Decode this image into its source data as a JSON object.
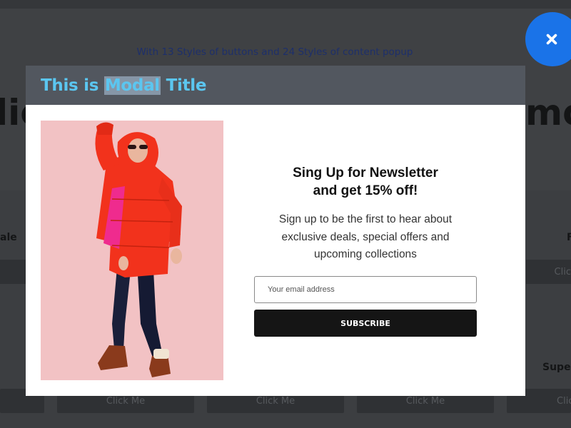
{
  "background": {
    "subtitle": "With 13 Styles of buttons and 24 Styles of content popup",
    "heading_left": "lic",
    "heading_right": "mo",
    "label_left": "ale",
    "label_right": "F",
    "label_super": "Super",
    "row1_button_right": "Clic",
    "row2_buttons": [
      "",
      "Click Me",
      "Click Me",
      "Click Me",
      "Clic"
    ]
  },
  "close_button": {
    "icon": "close-icon"
  },
  "modal": {
    "title_before": "This is ",
    "title_highlight": "Modal",
    "title_after": " Title",
    "image": {
      "icon": "woman-red-jacket-photo",
      "background": "#f2c2c4"
    },
    "newsletter": {
      "title_line1": "Sing Up for Newsletter",
      "title_line2": "and get 15% off!",
      "description_line1": "Sign up to be the first to hear about",
      "description_line2": "exclusive deals, special offers and",
      "description_line3": "upcoming collections",
      "email_placeholder": "Your email address",
      "subscribe_label": "SUBSCRIBE"
    }
  },
  "colors": {
    "accent_blue": "#1a73e8",
    "title_color": "#5bc6f0",
    "header_bg": "#52575f",
    "button_dark": "#151515"
  }
}
